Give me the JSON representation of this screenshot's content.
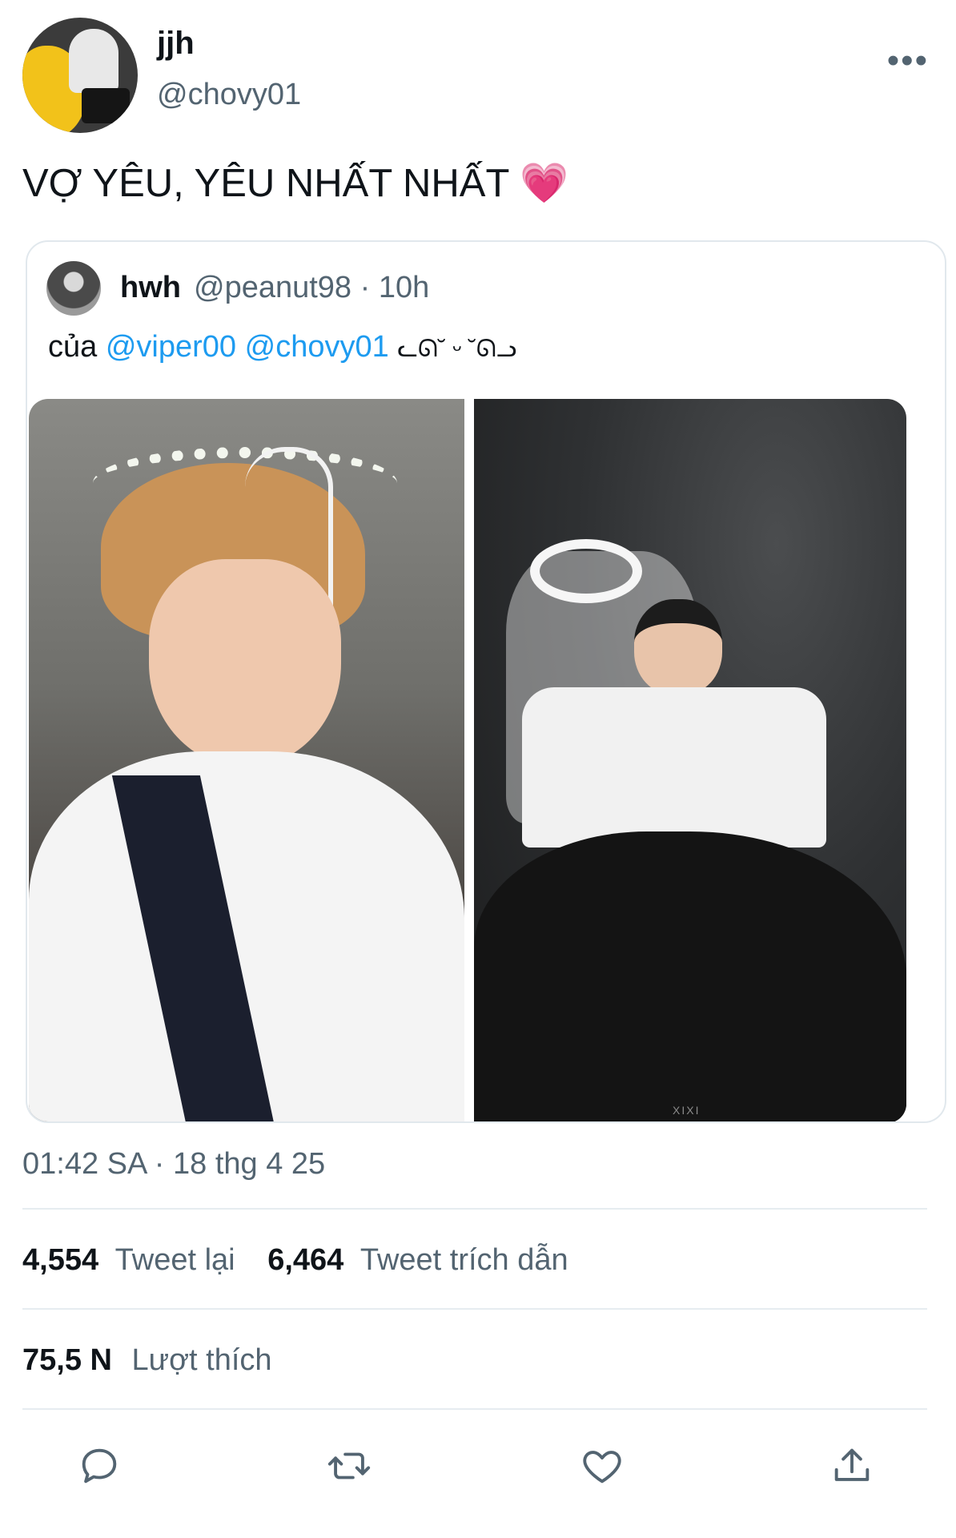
{
  "author": {
    "name": "jjh",
    "handle": "@chovy01"
  },
  "tweet": {
    "text": "VỢ YÊU, YÊU NHẤT NHẤT",
    "emoji": "💗"
  },
  "quoted": {
    "name": "hwh",
    "handle_time": "@peanut98 · 10h",
    "text_prefix": "của",
    "mention1": "@viper00",
    "mention2": "@chovy01",
    "text_suffix": "ᓚᘏ˘ ᵕ ˘ᘏᓗ",
    "watermark": "XIXI"
  },
  "timestamp": "01:42 SA · 18 thg 4 25",
  "stats": {
    "retweets_count": "4,554",
    "retweets_label": "Tweet lại",
    "quotes_count": "6,464",
    "quotes_label": "Tweet trích dẫn",
    "likes_count": "75,5 N",
    "likes_label": "Lượt thích"
  },
  "icons": [
    "more-icon",
    "reply-icon",
    "retweet-icon",
    "like-icon",
    "share-icon"
  ],
  "colors": {
    "mention": "#1d9bf0",
    "secondary_text": "#536471",
    "heart_emoji": "#ff4fa0"
  }
}
